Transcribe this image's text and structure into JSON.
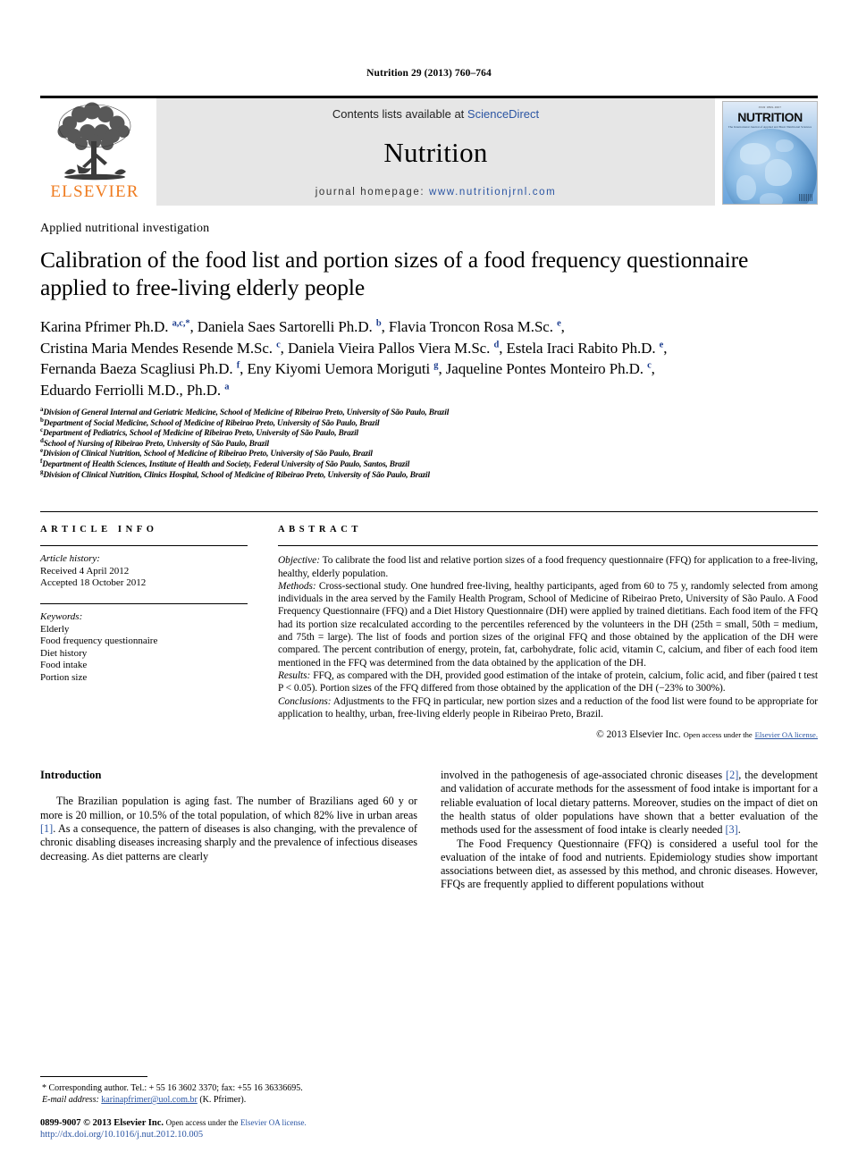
{
  "running_head": "Nutrition 29 (2013) 760–764",
  "masthead": {
    "publisher_logo_label": "ELSEVIER",
    "contents_prefix": "Contents lists available at",
    "contents_link": "ScienceDirect",
    "journal_name": "Nutrition",
    "homepage_prefix": "journal homepage:",
    "homepage_url": "www.nutritionjrnl.com",
    "cover": {
      "top_code": "ISSN 0899-9007",
      "title": "NUTRITION",
      "subtitle": "The International Journal of Applied and Basic Nutritional Sciences"
    }
  },
  "section_type": "Applied nutritional investigation",
  "title": "Calibration of the food list and portion sizes of a food frequency questionnaire applied to free-living elderly people",
  "authors_lines": [
    "Karina Pfrimer Ph.D. <sup>a,c,</sup><sup>*</sup>, Daniela Saes Sartorelli Ph.D. <sup>b</sup>, Flavia Troncon Rosa M.Sc. <sup>e</sup>,",
    "Cristina Maria Mendes Resende M.Sc. <sup>c</sup>, Daniela Vieira Pallos Viera M.Sc. <sup>d</sup>, Estela Iraci Rabito Ph.D. <sup>e</sup>,",
    "Fernanda Baeza Scagliusi Ph.D. <sup>f</sup>, Eny Kiyomi Uemora Moriguti <sup>g</sup>, Jaqueline Pontes Monteiro Ph.D. <sup>c</sup>,",
    "Eduardo Ferriolli M.D., Ph.D. <sup>a</sup>"
  ],
  "affiliations": [
    {
      "mark": "a",
      "text": "Division of General Internal and Geriatric Medicine, School of Medicine of Ribeirao Preto, University of São Paulo, Brazil"
    },
    {
      "mark": "b",
      "text": "Department of Social Medicine, School of Medicine of Ribeirao Preto, University of São Paulo, Brazil"
    },
    {
      "mark": "c",
      "text": "Department of Pediatrics, School of Medicine of Ribeirao Preto, University of São Paulo, Brazil"
    },
    {
      "mark": "d",
      "text": "School of Nursing of Ribeirao Preto, University of São Paulo, Brazil"
    },
    {
      "mark": "e",
      "text": "Division of Clinical Nutrition, School of Medicine of Ribeirao Preto, University of São Paulo, Brazil"
    },
    {
      "mark": "f",
      "text": "Department of Health Sciences, Institute of Health and Society, Federal University of São Paulo, Santos, Brazil"
    },
    {
      "mark": "g",
      "text": "Division of Clinical Nutrition, Clinics Hospital, School of Medicine of Ribeirao Preto, University of São Paulo, Brazil"
    }
  ],
  "article_info": {
    "heading": "ARTICLE INFO",
    "history_label": "Article history:",
    "received": "Received 4 April 2012",
    "accepted": "Accepted 18 October 2012",
    "keywords_label": "Keywords:",
    "keywords": [
      "Elderly",
      "Food frequency questionnaire",
      "Diet history",
      "Food intake",
      "Portion size"
    ]
  },
  "abstract": {
    "heading": "ABSTRACT",
    "objective_label": "Objective:",
    "objective_text": " To calibrate the food list and relative portion sizes of a food frequency questionnaire (FFQ) for application to a free-living, healthy, elderly population.",
    "methods_label": "Methods:",
    "methods_text": " Cross-sectional study. One hundred free-living, healthy participants, aged from 60 to 75 y, randomly selected from among individuals in the area served by the Family Health Program, School of Medicine of Ribeirao Preto, University of São Paulo. A Food Frequency Questionnaire (FFQ) and a Diet History Questionnaire (DH) were applied by trained dietitians. Each food item of the FFQ had its portion size recalculated according to the percentiles referenced by the volunteers in the DH (25th = small, 50th = medium, and 75th = large). The list of foods and portion sizes of the original FFQ and those obtained by the application of the DH were compared. The percent contribution of energy, protein, fat, carbohydrate, folic acid, vitamin C, calcium, and fiber of each food item mentioned in the FFQ was determined from the data obtained by the application of the DH.",
    "results_label": "Results:",
    "results_text": " FFQ, as compared with the DH, provided good estimation of the intake of protein, calcium, folic acid, and fiber (paired t test P < 0.05). Portion sizes of the FFQ differed from those obtained by the application of the DH (−23% to 300%).",
    "conclusions_label": "Conclusions:",
    "conclusions_text": " Adjustments to the FFQ in particular, new portion sizes and a reduction of the food list were found to be appropriate for application to healthy, urban, free-living elderly people in Ribeirao Preto, Brazil.",
    "copyright": "© 2013 Elsevier Inc.",
    "open_access_prefix": "Open access under the",
    "open_access_link": "Elsevier OA license."
  },
  "body": {
    "intro_heading": "Introduction",
    "left_paragraph": "The Brazilian population is aging fast. The number of Brazilians aged 60 y or more is 20 million, or 10.5% of the total population, of which 82% live in urban areas [1]. As a consequence, the pattern of diseases is also changing, with the prevalence of chronic disabling diseases increasing sharply and the prevalence of infectious diseases decreasing. As diet patterns are clearly",
    "right_paragraph_1": "involved in the pathogenesis of age-associated chronic diseases [2], the development and validation of accurate methods for the assessment of food intake is important for a reliable evaluation of local dietary patterns. Moreover, studies on the impact of diet on the health status of older populations have shown that a better evaluation of the methods used for the assessment of food intake is clearly needed [3].",
    "right_paragraph_2": "The Food Frequency Questionnaire (FFQ) is considered a useful tool for the evaluation of the intake of food and nutrients. Epidemiology studies show important associations between diet, as assessed by this method, and chronic diseases. However, FFQs are frequently applied to different populations without"
  },
  "footer": {
    "corresponding_star": "*",
    "corresponding_text": " Corresponding author. Tel.: + 55 16 3602 3370; fax: +55 16 36336695.",
    "email_label": "E-mail address:",
    "email": "karinapfrimer@uol.com.br",
    "email_suffix": " (K. Pfrimer).",
    "issn": "0899-9007",
    "issn_copyright": "© 2013 Elsevier Inc.",
    "issn_open_access": "Open access under the",
    "issn_link": "Elsevier OA license.",
    "doi": "http://dx.doi.org/10.1016/j.nut.2012.10.005"
  },
  "colors": {
    "link": "#2b55a3",
    "elsevier_orange": "#ef7c20",
    "band_gray": "#e6e6e6"
  }
}
